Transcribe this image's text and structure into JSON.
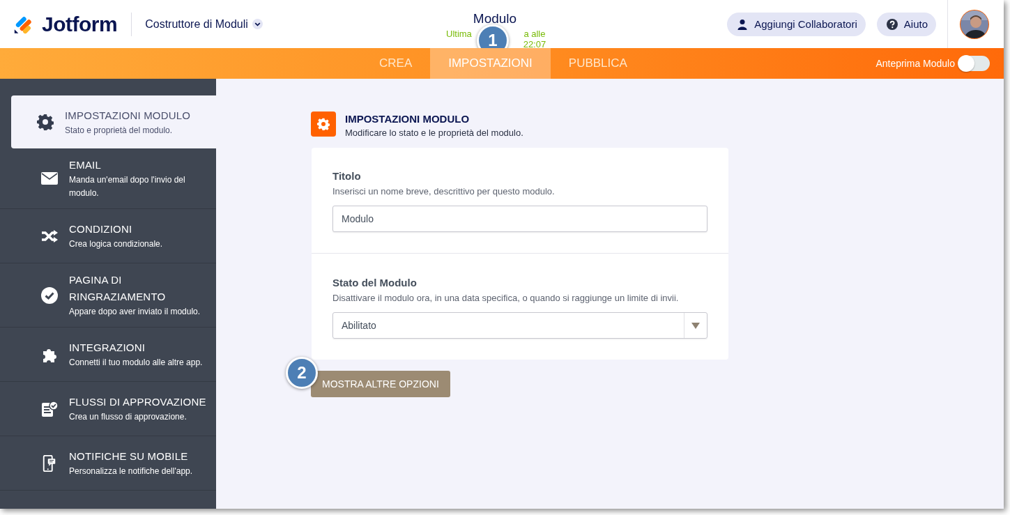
{
  "header": {
    "product": "Jotform",
    "builder_menu": "Costruttore di Moduli",
    "form_title": "Modulo",
    "saved_note_parts": [
      "Ultima",
      "a alle 22:07"
    ],
    "buttons": [
      {
        "kind": "collaborators",
        "label": "Aggiungi Collaboratori"
      },
      {
        "kind": "help",
        "label": "Aiuto"
      }
    ],
    "avatar": {
      "kind": "picture"
    }
  },
  "tabs": [
    {
      "label": "CREA",
      "selected": false
    },
    {
      "label": "IMPOSTAZIONI",
      "selected": true
    },
    {
      "label": "PUBBLICA",
      "selected": false
    }
  ],
  "preview_toggle": {
    "label": "Anteprima Modulo",
    "on": false
  },
  "sidebar": {
    "items": [
      {
        "kind": "gear",
        "title": "IMPOSTAZIONI MODULO",
        "subtitle": "Stato e proprietà del modulo.",
        "selected": true
      },
      {
        "kind": "mail",
        "title": "EMAIL",
        "subtitle": "Manda un'email dopo l'invio del modulo.",
        "selected": false
      },
      {
        "kind": "shuffle",
        "title": "CONDIZIONI",
        "subtitle": "Crea logica condizionale.",
        "selected": false
      },
      {
        "kind": "check",
        "title": "PAGINA DI RINGRAZIAMENTO",
        "subtitle": "Appare dopo aver inviato il modulo.",
        "selected": false
      },
      {
        "kind": "puzzle",
        "title": "INTEGRAZIONI",
        "subtitle": "Connetti il tuo modulo alle altre app.",
        "selected": false
      },
      {
        "kind": "approval",
        "title": "FLUSSI DI APPROVAZIONE",
        "subtitle": "Crea un flusso di approvazione.",
        "selected": false
      },
      {
        "kind": "mobile",
        "title": "NOTIFICHE SU MOBILE",
        "subtitle": "Personalizza le notifiche dell'app.",
        "selected": false
      }
    ]
  },
  "section": {
    "title": "IMPOSTAZIONI MODULO",
    "subtitle": "Modificare lo stato e le proprietà del modulo.",
    "fields": [
      {
        "kind": "text",
        "label": "Titolo",
        "help": "Inserisci un nome breve, descrittivo per questo modulo.",
        "value": "Modulo"
      },
      {
        "kind": "select",
        "label": "Stato del Modulo",
        "help": "Disattivare il modulo ora, in una data specifica, o quando si raggiunge un limite di invii.",
        "value": "Abilitato"
      }
    ],
    "more_button": "MOSTRA ALTRE OPZIONI"
  },
  "callouts": [
    "1",
    "2"
  ]
}
